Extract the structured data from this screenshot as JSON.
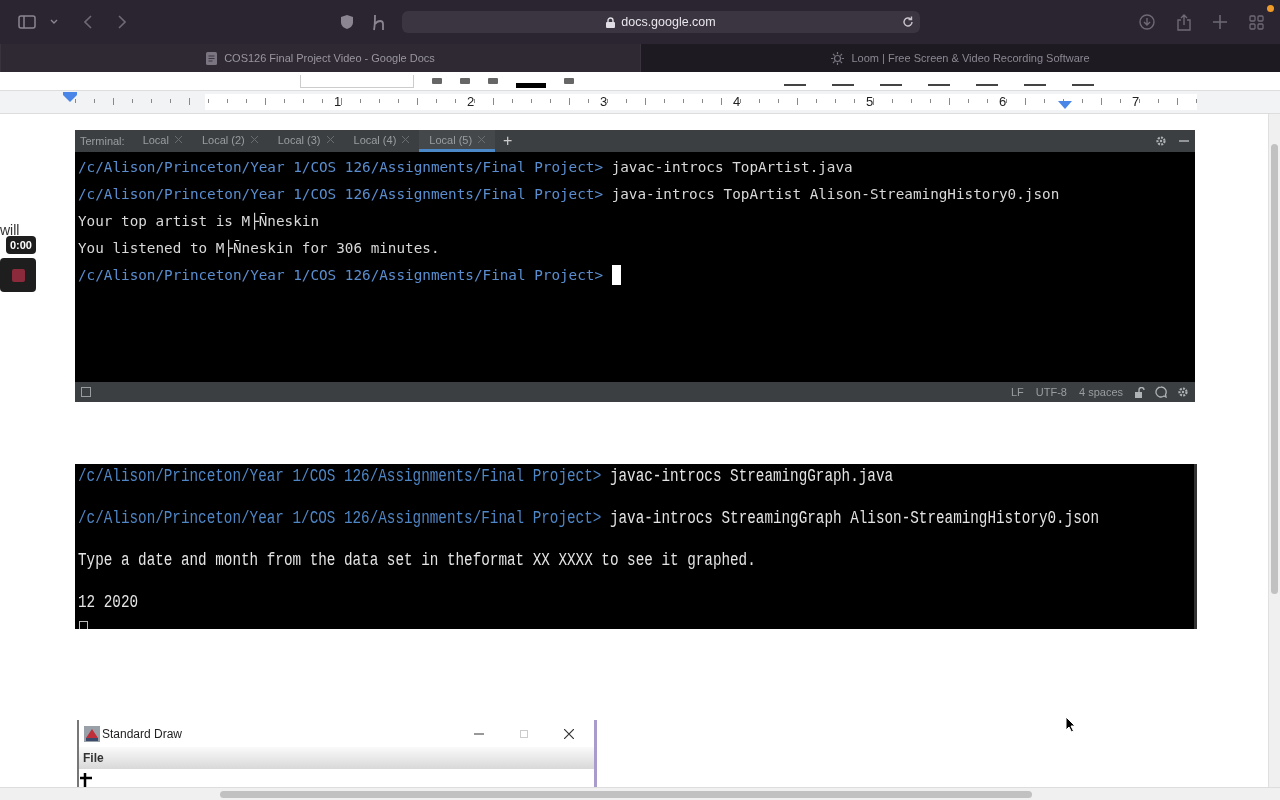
{
  "browser": {
    "address": "docs.google.com",
    "tabs": [
      {
        "title": "COS126 Final Project Video - Google Docs",
        "selected": true
      },
      {
        "title": "Loom | Free Screen & Video Recording Software",
        "selected": false
      }
    ]
  },
  "ruler": {
    "numbers": [
      "1",
      "2",
      "3",
      "4",
      "5",
      "6",
      "7"
    ]
  },
  "recorder": {
    "caption": "will",
    "timer": "0:00"
  },
  "terminal": {
    "label": "Terminal:",
    "tabs": [
      {
        "title": "Local",
        "selected": false
      },
      {
        "title": "Local (2)",
        "selected": false
      },
      {
        "title": "Local (3)",
        "selected": false
      },
      {
        "title": "Local (4)",
        "selected": false
      },
      {
        "title": "Local (5)",
        "selected": true
      }
    ],
    "add": "+",
    "lines": [
      {
        "kind": "command",
        "prompt": "/c/Alison/Princeton/Year 1/COS 126/Assignments/Final Project>",
        "command": "javac-introcs TopArtist.java"
      },
      {
        "kind": "command",
        "prompt": "/c/Alison/Princeton/Year 1/COS 126/Assignments/Final Project>",
        "command": "java-introcs TopArtist Alison-StreamingHistory0.json"
      },
      {
        "kind": "output",
        "text": "Your top artist is M├Ñneskin"
      },
      {
        "kind": "output",
        "text": "You listened to M├Ñneskin for 306 minutes."
      },
      {
        "kind": "cursor",
        "prompt": "/c/Alison/Princeton/Year 1/COS 126/Assignments/Final Project>"
      }
    ],
    "status": [
      "LF",
      "UTF-8",
      "4 spaces"
    ]
  },
  "screenshot_terminal": {
    "lines": [
      {
        "kind": "command",
        "prompt": "/c/Alison/Princeton/Year 1/COS 126/Assignments/Final Project>",
        "command": "javac-introcs StreamingGraph.java"
      },
      {
        "kind": "command",
        "prompt": "/c/Alison/Princeton/Year 1/COS 126/Assignments/Final Project>",
        "command": "java-introcs StreamingGraph Alison-StreamingHistory0.json"
      },
      {
        "kind": "output",
        "text": "Type a date and month from the data set in theformat XX XXXX to see it graphed."
      },
      {
        "kind": "output",
        "text": "12 2020"
      }
    ]
  },
  "stddraw": {
    "title": "Standard Draw",
    "menu": [
      "File"
    ]
  }
}
